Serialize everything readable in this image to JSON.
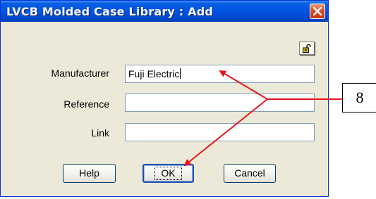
{
  "window": {
    "title": "LVCB Molded Case Library : Add"
  },
  "form": {
    "manufacturer_label": "Manufacturer",
    "manufacturer_value": "Fuji Electric",
    "reference_label": "Reference",
    "reference_value": "",
    "link_label": "Link",
    "link_value": ""
  },
  "buttons": {
    "help": "Help",
    "ok": "OK",
    "cancel": "Cancel"
  },
  "annotation": {
    "callout_number": "8",
    "arrow_color": "#e8141b"
  },
  "icons": {
    "close": "close-icon",
    "lock": "lock-icon"
  }
}
